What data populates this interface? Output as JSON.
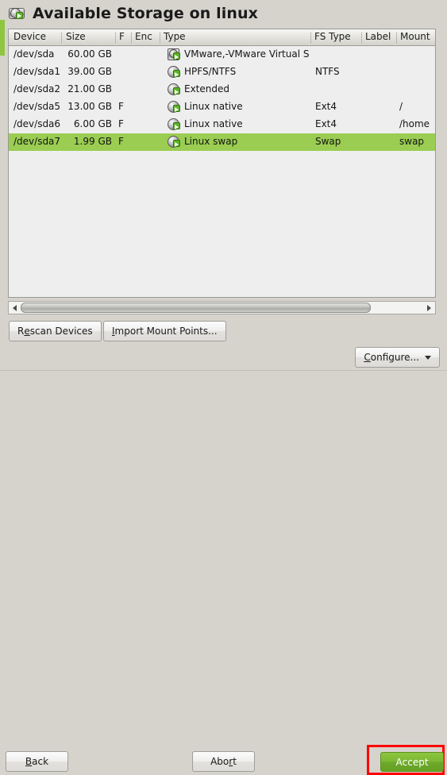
{
  "window": {
    "title": "Available Storage on linux",
    "title_icon": "hard-disk-icon",
    "background_color": "#d6d3cd",
    "step_strip_color": "#8ec63f"
  },
  "table": {
    "columns": [
      {
        "key": "device",
        "label": "Device"
      },
      {
        "key": "size",
        "label": "Size"
      },
      {
        "key": "f",
        "label": "F"
      },
      {
        "key": "enc",
        "label": "Enc"
      },
      {
        "key": "type",
        "label": "Type"
      },
      {
        "key": "fstype",
        "label": "FS Type"
      },
      {
        "key": "label",
        "label": "Label"
      },
      {
        "key": "mount",
        "label": "Mount"
      }
    ],
    "selected_row_index": 5,
    "selected_row_color": "#9ACD52",
    "rows": [
      {
        "device": "/dev/sda",
        "size": "60.00 GB",
        "f": "",
        "enc": "",
        "icon": "hard-disk-icon",
        "type": "VMware,-VMware Virtual S",
        "fstype": "",
        "label": "",
        "mount": "",
        "selected": false
      },
      {
        "device": "/dev/sda1",
        "size": "39.00 GB",
        "f": "",
        "enc": "",
        "icon": "partition-icon",
        "type": "HPFS/NTFS",
        "fstype": "NTFS",
        "label": "",
        "mount": "",
        "selected": false
      },
      {
        "device": "/dev/sda2",
        "size": "21.00 GB",
        "f": "",
        "enc": "",
        "icon": "partition-icon",
        "type": "Extended",
        "fstype": "",
        "label": "",
        "mount": "",
        "selected": false
      },
      {
        "device": "/dev/sda5",
        "size": "13.00 GB",
        "f": "F",
        "enc": "",
        "icon": "partition-icon",
        "type": "Linux native",
        "fstype": "Ext4",
        "label": "",
        "mount": "/",
        "selected": false
      },
      {
        "device": "/dev/sda6",
        "size": "6.00 GB",
        "f": "F",
        "enc": "",
        "icon": "partition-icon",
        "type": "Linux native",
        "fstype": "Ext4",
        "label": "",
        "mount": "/home",
        "selected": false
      },
      {
        "device": "/dev/sda7",
        "size": "1.99 GB",
        "f": "F",
        "enc": "",
        "icon": "partition-icon",
        "type": "Linux swap",
        "fstype": "Swap",
        "label": "",
        "mount": "swap",
        "selected": true
      }
    ]
  },
  "scrollbar": {
    "left_arrow_icon": "triangle-left-icon",
    "right_arrow_icon": "triangle-right-icon",
    "thumb_fraction_percent": 87
  },
  "actions": {
    "rescan": {
      "pre": "R",
      "accel": "e",
      "post": "scan Devices"
    },
    "import": {
      "pre": "",
      "accel": "I",
      "post": "mport Mount Points..."
    },
    "configure": {
      "pre": "",
      "accel": "C",
      "post": "onfigure...",
      "caret_icon": "chevron-down-icon"
    }
  },
  "navigation": {
    "back": {
      "pre": "",
      "accel": "B",
      "post": "ack"
    },
    "abort": {
      "pre": "Abo",
      "accel": "r",
      "post": "t"
    },
    "accept": {
      "pre": "",
      "accel": "A",
      "post": "ccept"
    }
  },
  "highlight": {
    "target": "accept-button",
    "color": "#ff0000"
  }
}
